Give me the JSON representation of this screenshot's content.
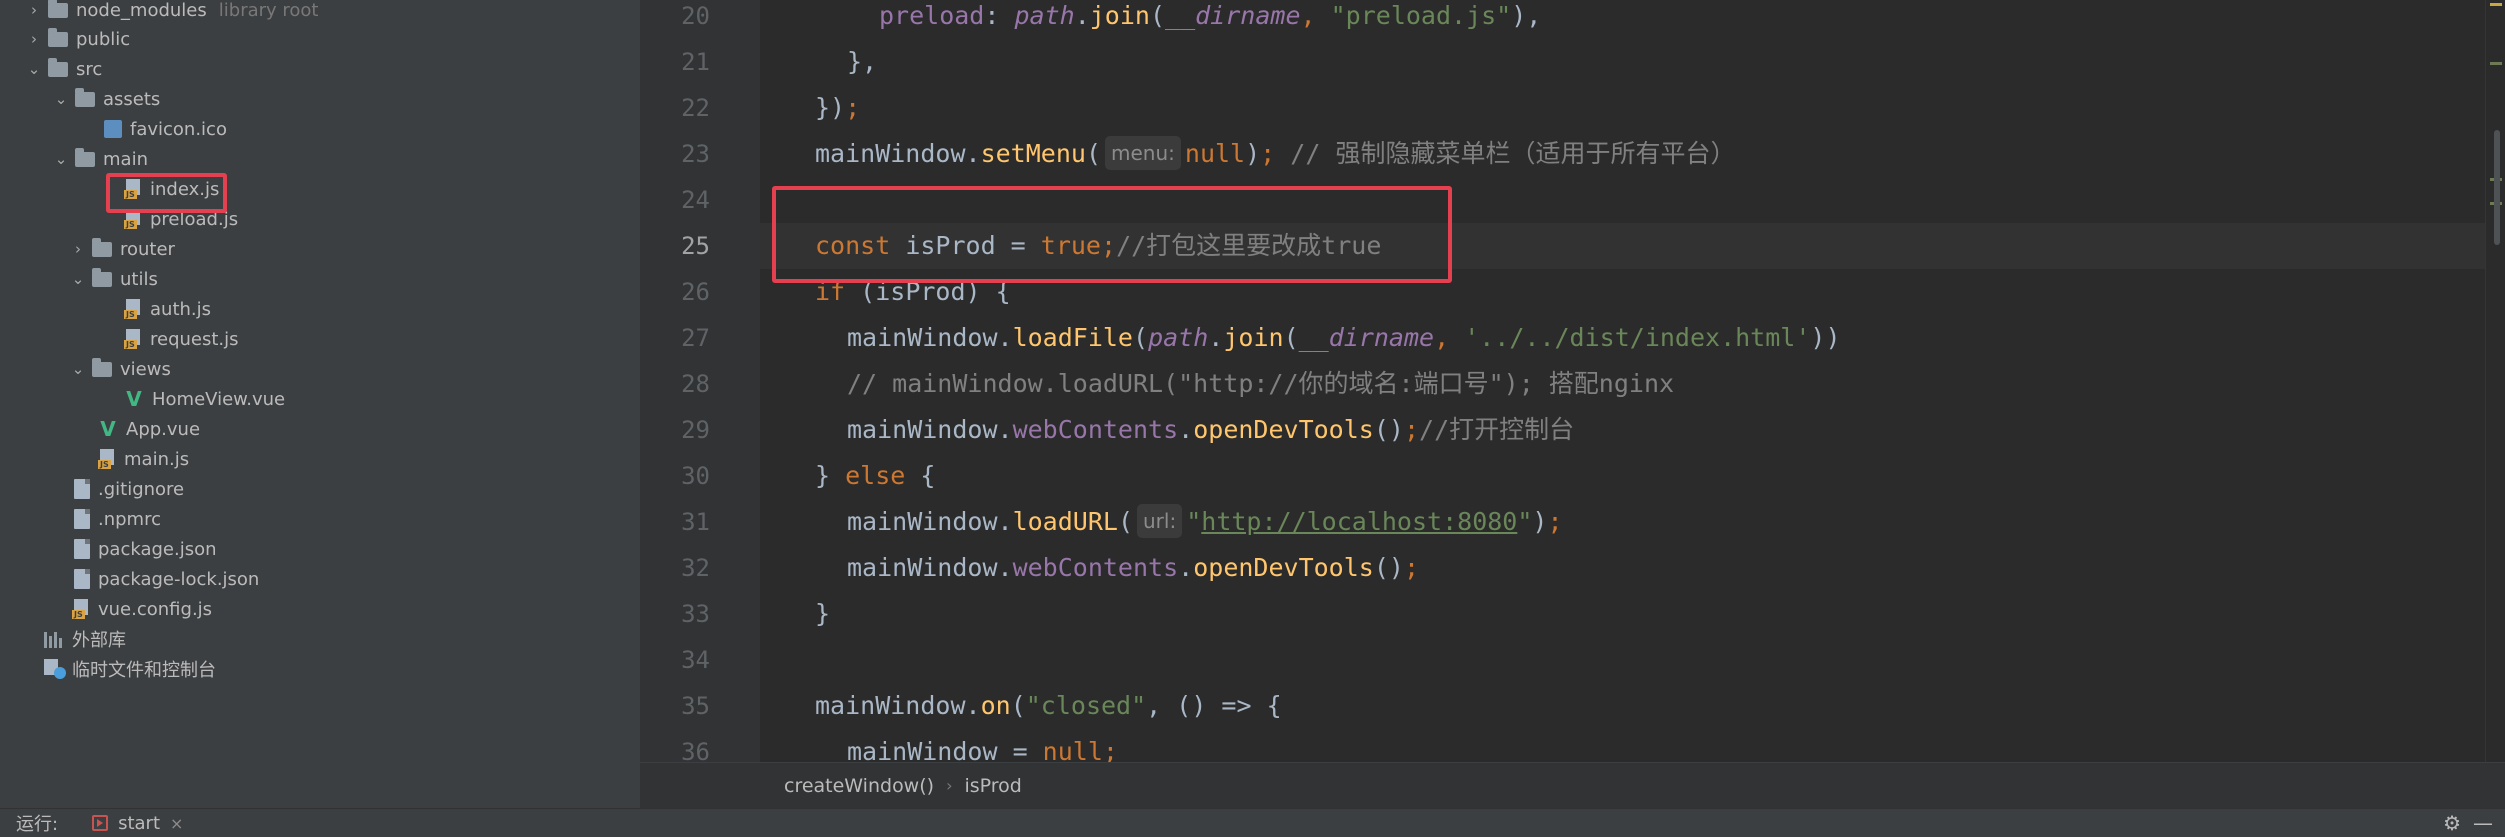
{
  "tree": {
    "items": [
      {
        "label": "node_modules",
        "hint": "library root"
      },
      {
        "label": "public"
      },
      {
        "label": "src"
      },
      {
        "label": "assets"
      },
      {
        "label": "favicon.ico"
      },
      {
        "label": "main"
      },
      {
        "label": "index.js"
      },
      {
        "label": "preload.js"
      },
      {
        "label": "router"
      },
      {
        "label": "utils"
      },
      {
        "label": "auth.js"
      },
      {
        "label": "request.js"
      },
      {
        "label": "views"
      },
      {
        "label": "HomeView.vue"
      },
      {
        "label": "App.vue"
      },
      {
        "label": "main.js"
      },
      {
        "label": ".gitignore"
      },
      {
        "label": ".npmrc"
      },
      {
        "label": "package.json"
      },
      {
        "label": "package-lock.json"
      },
      {
        "label": "vue.config.js"
      },
      {
        "label": "外部库"
      },
      {
        "label": "临时文件和控制台"
      }
    ]
  },
  "editor": {
    "line_numbers": [
      "20",
      "21",
      "22",
      "23",
      "24",
      "25",
      "26",
      "27",
      "28",
      "29",
      "30",
      "31",
      "32",
      "33",
      "34",
      "35",
      "36"
    ],
    "current_line": "25",
    "code": {
      "l20": {
        "k1": "preload",
        "p1": ": ",
        "it1": "path",
        "p2": ".",
        "fn1": "join",
        "p3": "(",
        "it2": "__dirname",
        "p4": ", ",
        "s1": "\"preload.js\"",
        "p5": "),"
      },
      "l21": {
        "p1": "},"
      },
      "l22": {
        "p1": "})",
        "k1": ";"
      },
      "l23": {
        "p1": "mainWindow.",
        "fn1": "setMenu",
        "p2": "(",
        "hint": "menu:",
        "k1": "null",
        "p3": ")",
        "k2": ";",
        "c1": " // 强制隐藏菜单栏（适用于所有平台）"
      },
      "l25": {
        "k1": "const",
        "p1": " isProd = ",
        "k2": "true",
        "k3": ";",
        "c1": "//打包这里要改成true"
      },
      "l26": {
        "k1": "if",
        "p1": " (isProd) {"
      },
      "l27": {
        "p1": "mainWindow.",
        "fn1": "loadFile",
        "p2": "(",
        "it1": "path",
        "p3": ".",
        "fn2": "join",
        "p4": "(",
        "it2": "__dirname",
        "p5": ", ",
        "s1": "'../../dist/index.html'",
        "p6": "))"
      },
      "l28": {
        "c1": "// mainWindow.loadURL(\"http://你的域名:端口号\"); 搭配nginx"
      },
      "l29": {
        "p1": "mainWindow.",
        "pr1": "webContents",
        "p2": ".",
        "fn1": "openDevTools",
        "p3": "()",
        "k1": ";",
        "c1": "//打开控制台"
      },
      "l30": {
        "p1": "} ",
        "k1": "else",
        "p2": " {"
      },
      "l31": {
        "p1": "mainWindow.",
        "fn1": "loadURL",
        "p2": "(",
        "hint": "url:",
        "s1": "\"",
        "u1": "http://localhost:8080",
        "s2": "\"",
        "p3": ")",
        "k1": ";"
      },
      "l32": {
        "p1": "mainWindow.",
        "pr1": "webContents",
        "p2": ".",
        "fn1": "openDevTools",
        "p3": "()",
        "k1": ";"
      },
      "l33": {
        "p1": "}"
      },
      "l35": {
        "p1": "mainWindow.",
        "fn1": "on",
        "p2": "(",
        "s1": "\"closed\"",
        "p3": ", () => {"
      },
      "l36": {
        "p1": "mainWindow = ",
        "k1": "null",
        "k2": ";"
      }
    }
  },
  "breadcrumb": {
    "items": [
      "createWindow()",
      "isProd"
    ]
  },
  "run": {
    "label": "运行:",
    "tab": "start",
    "close": "×",
    "gear": "⚙",
    "dash": "—"
  },
  "colors": {
    "keyword": "#cc7832",
    "function": "#ffc66d",
    "string": "#6a8759",
    "comment": "#808080",
    "property": "#9876aa",
    "highlight": "#e5404f"
  }
}
